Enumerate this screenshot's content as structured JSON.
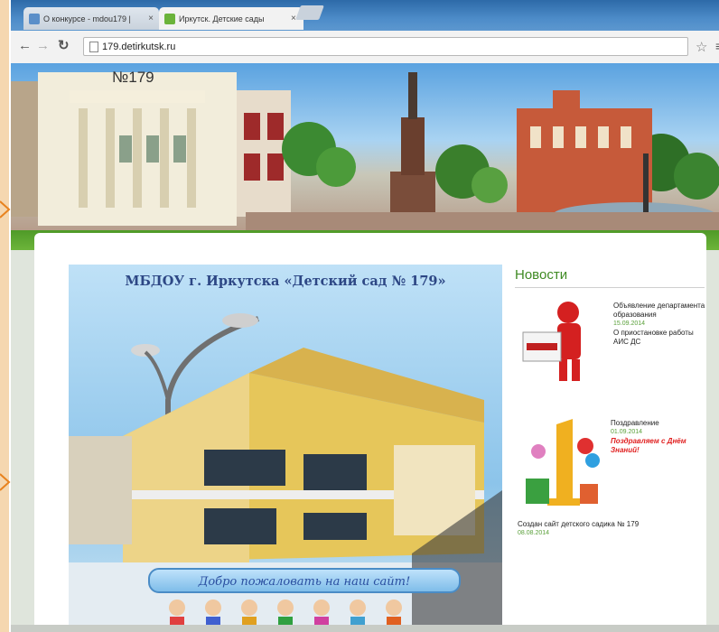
{
  "browser": {
    "tabs": [
      {
        "label": "О конкурсе - mdou179 |",
        "close": "×",
        "active": false
      },
      {
        "label": "Иркутск. Детские сады",
        "close": "×",
        "active": true
      }
    ],
    "url": "179.detirkutsk.ru"
  },
  "site": {
    "number": "№179",
    "hero_title": "МБДОУ г. Иркутска «Детский сад № 179»",
    "hero_welcome": "Добро пожаловать на наш сайт!"
  },
  "news": {
    "heading": "Новости",
    "items": [
      {
        "title": "Объявление департамента образования",
        "date": "15.09.2014",
        "text": "О приостановке работы АИС ДС"
      },
      {
        "title": "Поздравление",
        "date": "01.09.2014",
        "text": "Поздравляем с Днём Знаний!"
      },
      {
        "title": "Создан сайт детского садика № 179",
        "date": "08.08.2014"
      }
    ]
  },
  "colors": {
    "accent": "#3f8a23",
    "title": "#2d4785",
    "news_red": "#e02020"
  }
}
